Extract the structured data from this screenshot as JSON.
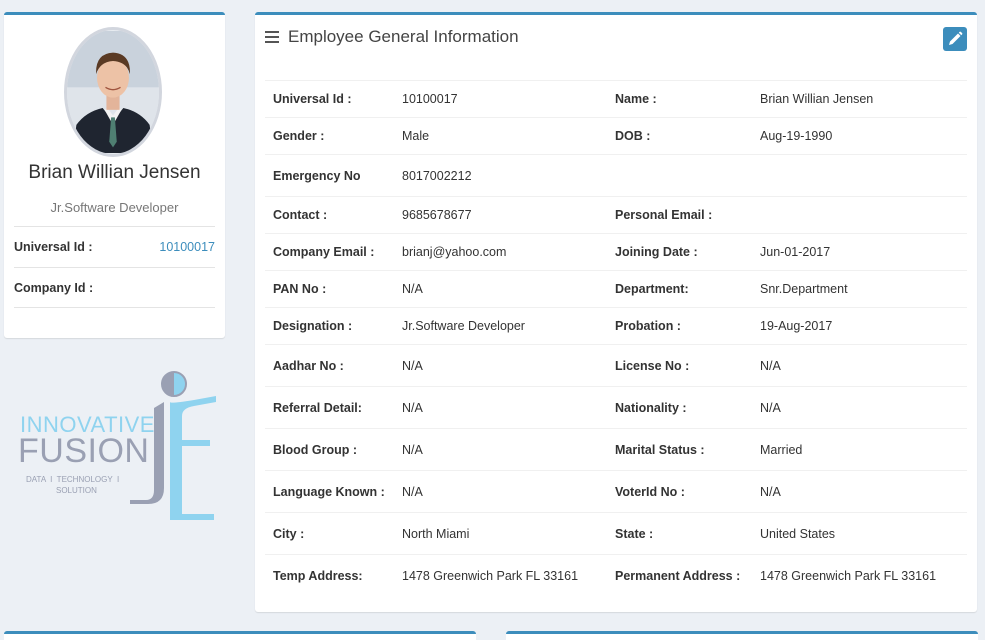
{
  "profile": {
    "name": "Brian Willian Jensen",
    "role": "Jr.Software Developer",
    "items": [
      {
        "label": "Universal Id :",
        "value": "10100017"
      },
      {
        "label": "Company Id :",
        "value": ""
      }
    ]
  },
  "logo": {
    "line1": "INNOVATIVE",
    "line2": "FUSION",
    "tagline1": "DATA  I  TECHNOLOGY  I",
    "tagline2": "SOLUTION"
  },
  "main": {
    "title": "Employee General Information",
    "edit_icon": "pencil-icon",
    "menu_icon": "bars-icon",
    "rows": [
      {
        "l1": "Universal Id :",
        "v1": "10100017",
        "l2": "Name :",
        "v2": "Brian Willian Jensen"
      },
      {
        "l1": "Gender :",
        "v1": "Male",
        "l2": "DOB :",
        "v2": "Aug-19-1990"
      },
      {
        "l1": "Emergency No",
        "v1": "8017002212",
        "l2": "",
        "v2": ""
      },
      {
        "l1": "Contact :",
        "v1": "9685678677",
        "l2": "Personal Email :",
        "v2": ""
      },
      {
        "l1": "Company Email :",
        "v1": "brianj@yahoo.com",
        "l2": "Joining Date :",
        "v2": "Jun-01-2017"
      },
      {
        "l1": "PAN No :",
        "v1": "N/A",
        "l2": "Department:",
        "v2": "Snr.Department"
      },
      {
        "l1": "Designation :",
        "v1": "Jr.Software Developer",
        "l2": "Probation :",
        "v2": "19-Aug-2017"
      },
      {
        "l1": "Aadhar No :",
        "v1": "N/A",
        "l2": "License No :",
        "v2": "N/A"
      },
      {
        "l1": "Referral Detail:",
        "v1": "N/A",
        "l2": "Nationality :",
        "v2": "N/A"
      },
      {
        "l1": "Blood Group :",
        "v1": "N/A",
        "l2": "Marital Status :",
        "v2": "Married"
      },
      {
        "l1": "Language Known :",
        "v1": "N/A",
        "l2": "VoterId No :",
        "v2": "N/A"
      },
      {
        "l1": "City :",
        "v1": "North Miami",
        "l2": "State :",
        "v2": "United States"
      },
      {
        "l1": "Temp Address:",
        "v1": "1478 Greenwich Park FL 33161",
        "l2": "Permanent Address :",
        "v2": "1478 Greenwich Park FL 33161"
      }
    ]
  },
  "colors": {
    "accent": "#3c8dbc",
    "background": "#ecf0f5",
    "logo_gray": "#9aa0b3",
    "logo_blue": "#8fd3ef"
  }
}
